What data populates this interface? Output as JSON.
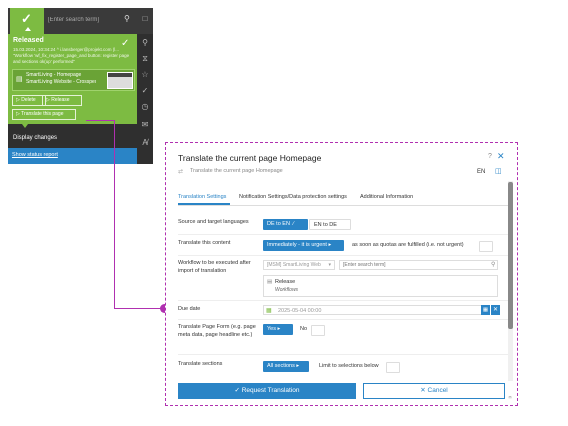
{
  "left_panel": {
    "search_placeholder": "[Enter search term]",
    "status": {
      "title": "Released",
      "meta": "15.03.2024, 10:34:24 ^ i.lansberger@projekt.com (l...",
      "note": "\"Workflow 'wf_fix_register_page_and button: register page and sections ok(up' performed\""
    },
    "page": {
      "line1": "SmartLiving - Homepage",
      "line2": "SmartLiving Website - Crosspedi..."
    },
    "buttons": {
      "delete": "Delete",
      "release": "Release",
      "translate_page": "Translate this page"
    },
    "display_changes": "Display changes",
    "status_report": "Show status report"
  },
  "dialog": {
    "title": "Translate the current page Homepage",
    "subtitle": "Translate the current page Homepage",
    "language": "EN",
    "tabs": [
      {
        "label": "Translation Settings",
        "active": true
      },
      {
        "label": "Notification Settings/Data protection settings",
        "active": false
      },
      {
        "label": "Additional Information",
        "active": false
      }
    ],
    "fields": {
      "source_target": {
        "label": "Source and target languages",
        "option1": "DE to EN",
        "option2": "EN to DE"
      },
      "translate_content": {
        "label": "Translate this content",
        "selected": "Immediately - it is urgent",
        "alternative": "as soon as quotas are fulfilled (i.e. not urgent)"
      },
      "workflow": {
        "label": "Workflow to be executed after import of translation",
        "select_value": "[MSM] SmartLiving Web",
        "search_placeholder": "[Enter search term]",
        "item_name": "Release",
        "item_type": "Workflows"
      },
      "due_date": {
        "label": "Due date",
        "value": "2025-05-04 00:00"
      },
      "page_form": {
        "label": "Translate Page Form (e.g. page meta data, page headline etc.)",
        "yes": "Yes",
        "no": "No"
      },
      "sections": {
        "label": "Translate sections",
        "selected": "All sections",
        "alternative": "Limit to selections below"
      }
    },
    "actions": {
      "request": "Request Translation",
      "cancel": "Cancel"
    }
  },
  "colors": {
    "green": "#7dbb42",
    "blue": "#2a84c6",
    "connector": "#b030b0",
    "dark": "#2f2f2f"
  }
}
